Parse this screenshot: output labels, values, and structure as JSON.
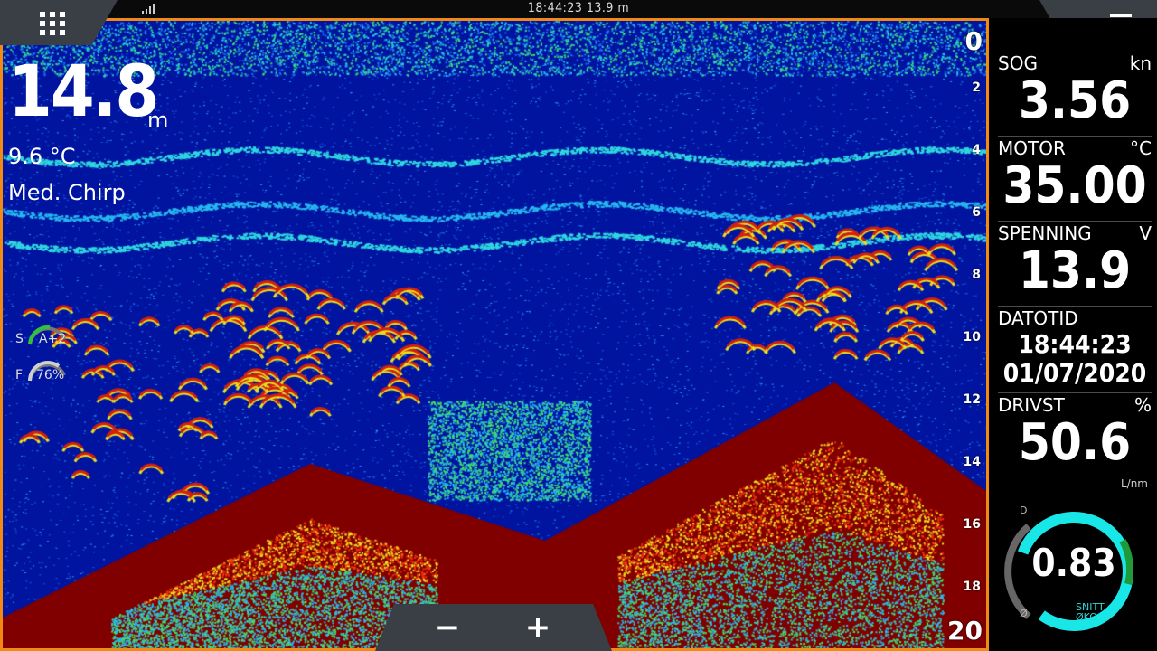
{
  "status_bar": {
    "time": "18:44:23",
    "depth_readout": "13.9 m",
    "clock_text": "18:44:23   13.9 m"
  },
  "sonar": {
    "depth": "14.8",
    "depth_unit": "m",
    "water_temp": "9.6 °C",
    "mode": "Med. Chirp",
    "sensitivity_label": "S",
    "sensitivity_value": "A+2",
    "frequency_label": "F",
    "frequency_value": "76%",
    "range_scale": [
      "0",
      "2",
      "4",
      "6",
      "8",
      "10",
      "12",
      "14",
      "16",
      "18",
      "20"
    ]
  },
  "zoom": {
    "out_label": "−",
    "in_label": "+"
  },
  "databar": {
    "sog": {
      "label": "SOG",
      "unit": "kn",
      "value": "3.56"
    },
    "motor": {
      "label": "MOTOR",
      "unit": "°C",
      "value": "35.00"
    },
    "voltage": {
      "label": "SPENNING",
      "unit": "V",
      "value": "13.9"
    },
    "datetime": {
      "label": "DATOTID",
      "time": "18:44:23",
      "date": "01/07/2020"
    },
    "fuel": {
      "label": "DRIVST",
      "unit": "%",
      "value": "50.6"
    },
    "economy": {
      "unit": "L/nm",
      "value": "0.83",
      "avg_line1": "SNITT",
      "avg_line2": "ØKO",
      "max_label": "D",
      "min_label": "Ø"
    }
  },
  "colors": {
    "accent": "#f08a12",
    "water": "#0014a0",
    "bottom": "#800000",
    "gauge": "#19e6e6"
  }
}
